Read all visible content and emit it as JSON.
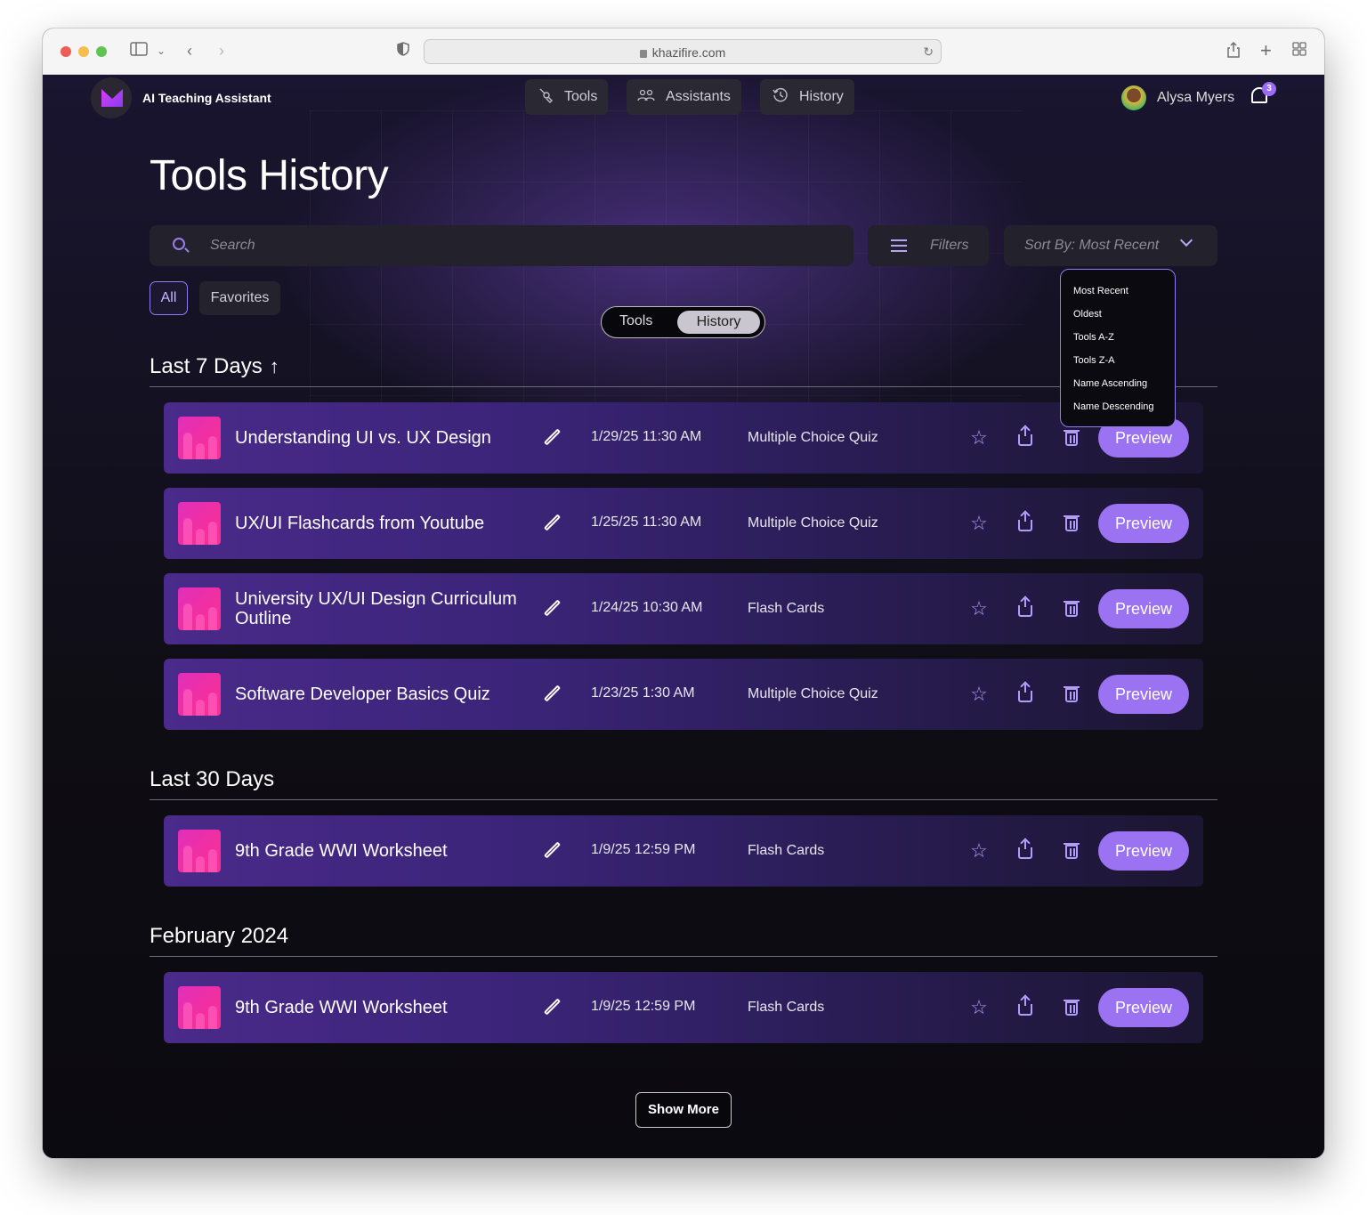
{
  "browser": {
    "url": "khazifire.com"
  },
  "app": {
    "name": "AI Teaching Assistant",
    "nav": [
      {
        "label": "Tools",
        "icon": "wrench-icon"
      },
      {
        "label": "Assistants",
        "icon": "people-icon"
      },
      {
        "label": "History",
        "icon": "history-icon"
      }
    ],
    "user": {
      "name": "Alysa Myers",
      "notifications": "3"
    }
  },
  "page": {
    "title": "Tools History",
    "search_placeholder": "Search",
    "filters_label": "Filters",
    "sort_label": "Sort By: Most Recent",
    "sort_options": [
      "Most Recent",
      "Oldest",
      "Tools A-Z",
      "Tools Z-A",
      "Name Ascending",
      "Name Descending"
    ],
    "tabs": {
      "all": "All",
      "favorites": "Favorites"
    },
    "toggle": {
      "tools": "Tools",
      "history": "History"
    },
    "show_more": "Show More"
  },
  "sections": [
    {
      "title": "Last 7 Days",
      "rows": [
        {
          "title": "Understanding UI vs. UX Design",
          "date": "1/29/25 11:30 AM",
          "type": "Multiple Choice Quiz"
        },
        {
          "title": "UX/UI Flashcards from Youtube",
          "date": "1/25/25 11:30 AM",
          "type": "Multiple Choice Quiz"
        },
        {
          "title": "University UX/UI Design Curriculum Outline",
          "date": "1/24/25 10:30 AM",
          "type": "Flash Cards"
        },
        {
          "title": "Software Developer Basics Quiz",
          "date": "1/23/25 1:30 AM",
          "type": "Multiple Choice Quiz"
        }
      ]
    },
    {
      "title": "Last 30 Days",
      "rows": [
        {
          "title": "9th Grade WWI Worksheet",
          "date": "1/9/25 12:59 PM",
          "type": "Flash Cards"
        }
      ]
    },
    {
      "title": "February 2024",
      "rows": [
        {
          "title": "9th Grade WWI Worksheet",
          "date": "1/9/25 12:59 PM",
          "type": "Flash Cards"
        }
      ]
    }
  ],
  "row_actions": {
    "preview": "Preview"
  },
  "colors": {
    "accent": "#9a72f2",
    "background": "#0e0d13",
    "row_start": "#4a2a8a"
  }
}
